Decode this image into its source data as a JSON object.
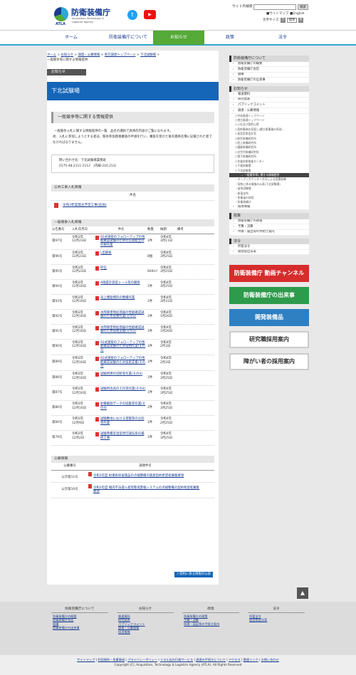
{
  "header": {
    "site_search_label": "サイト内検索",
    "search_button": "検索",
    "sitemap": "サイトマップ",
    "english": "English",
    "text_size_label": "文字サイズ",
    "size_small": "小",
    "size_normal": "標準",
    "size_large": "大",
    "logo_main": "防衛装備庁",
    "logo_sub1": "Acquisition,Technology &",
    "logo_sub2": "Logistics Agency",
    "logo_atla": "ATLA"
  },
  "nav": [
    {
      "label": "ホーム"
    },
    {
      "label": "防衛装備庁について"
    },
    {
      "label": "お知らせ"
    },
    {
      "label": "政策"
    },
    {
      "label": "法令"
    }
  ],
  "breadcrumb": [
    "ホーム",
    "お知らせ",
    "調達・公募情報",
    "地方調達トップページ",
    "下北試験場",
    "一般競争等に関する情報提供"
  ],
  "page": {
    "category": "お知らせ",
    "title": "下北試験場",
    "subtitle": "一般競争等に関する情報提供",
    "intro": "一般競争入札に関する情報提供の一覧　品名の選択で具体的内容がご覧になれます。",
    "note": "尚、入札に参加しようとする者は、競争参加資格審査の申請を行い、審査を受けた後有資格名簿に記載された者でなければなりません。",
    "contact1": "問い合わせ先：下北試験場業務班",
    "contact2": "0175-48-2111-2112　(内線-210,213)"
  },
  "public_works": {
    "heading": "公共工事入札情報",
    "col_name": "件名",
    "items": [
      "令和3年度発注予定工事(追加)"
    ]
  },
  "competitive": {
    "heading": "一般競争入札情報",
    "headers": [
      "公告番号",
      "入札年月日",
      "件名",
      "数量",
      "納期",
      "備考"
    ],
    "rows": [
      {
        "no": "第97号",
        "date": "令和3年\n12月23日",
        "name": "92式遠管のフォローアップの性能確認試験のための信管組立の作製作業",
        "qty": "1件",
        "due": "令和4年\n3月11日"
      },
      {
        "no": "第96号",
        "date": "令和3年\n12月23日",
        "name": "L型鋼板",
        "qty": "8個",
        "due": "令和4年\n3月25日"
      },
      {
        "no": "第95号",
        "date": "令和3年\n12月23日",
        "name": "砕石",
        "qty": "600m³",
        "due": "令和4年\n3月25日"
      },
      {
        "no": "第94号",
        "date": "令和3年\n12月16日",
        "name": "A砲座計測室レール等の補修",
        "qty": "1件",
        "due": "令和4年\n3月25日"
      },
      {
        "no": "第93号",
        "date": "令和3年\n12月16日",
        "name": "海上爆発標的の整備作業",
        "qty": "1件",
        "due": "令和4年\n3月31日"
      },
      {
        "no": "第92号",
        "date": "令和3年\n12月16日",
        "name": "水際障害物処理器の性能確認試験のため役務作業(その2)",
        "qty": "1件",
        "due": "令和4年\n1月26日"
      },
      {
        "no": "第91号",
        "date": "令和3年\n12月16日",
        "name": "水際障害物処理器の性能確認試験のため技術支援(その2)",
        "qty": "1件",
        "due": "令和4年\n1月26日"
      },
      {
        "no": "第90号",
        "date": "令和3年\n12月16日",
        "name": "92式遠管のフォローアップの性能確認試験のため役務作業(その3)",
        "qty": "1件",
        "due": "令和4年\n2月3日"
      },
      {
        "no": "第89号",
        "date": "令和3年\n12月16日",
        "name": "92式遠管のフォローアップの性能確認試験のため技術支援(その3)",
        "qty": "1件",
        "due": "令和4年\n2月3日"
      },
      {
        "no": "第88号",
        "date": "令和3年\n12月16日",
        "name": "試験用弾の切断等作業(その4)",
        "qty": "1件",
        "due": "令和4年\n3月25日"
      },
      {
        "no": "第87号",
        "date": "令和3年\n12月16日",
        "name": "試験用治具の工作等作業(その4)",
        "qty": "1件",
        "due": "令和4年\n3月25日"
      },
      {
        "no": "第86号",
        "date": "令和3年\n12月16日",
        "name": "射撃観測データの収集等作業(その4)",
        "qty": "1件",
        "due": "令和4年\n3月25日"
      },
      {
        "no": "第84号",
        "date": "令和3年\n12月9日",
        "name": "試験敷地における害獣等の分別等作業",
        "qty": "1件",
        "due": "令和4年\n2月25日"
      },
      {
        "no": "第79号",
        "date": "令和3年\n12月2日",
        "name": "試験準備室温室用空調気系の補修工事",
        "qty": "1件",
        "due": "令和4年\n3月25日"
      }
    ]
  },
  "kobo": {
    "heading": "公募情報",
    "col_no": "公募番号",
    "col_name": "調達件名",
    "rows": [
      {
        "no": "公示第11号",
        "name": "令和3年度 射場各係留施設の点検整備の随意契約希望者募集要領"
      },
      {
        "no": "公示第10号",
        "name": "令和3年度 場内不法侵入者等警戒警報システムの点検整備の契約希望者募集要領"
      }
    ]
  },
  "contract_link": "＞契約に係る情報の公表",
  "sidebar": {
    "about_heading": "防衛装備庁について",
    "about_items": [
      "防衛装備庁の概要",
      "防衛装備庁長官",
      "組織",
      "防衛装備庁の出来事"
    ],
    "news_heading": "お知らせ",
    "news_items": [
      "報道資料",
      "研究発表",
      "パブリックコメント",
      "調達・公募情報"
    ],
    "sub_items": [
      "中央調達トップページ",
      "地方調達トップページ",
      "入札及び契約心得",
      "契約事務の見直し(最大限事業の再発...",
      "長官官房会計官",
      "航空装備研究所",
      "陸上装備研究所",
      "艦艇装備研究所",
      "次世代装備研究所",
      "電子装備研究所",
      "先進技術推進センター",
      "千歳試験場",
      "下北試験場"
    ],
    "current_item": "一般競争等に関する情報提供",
    "sub_items2": [
      "オープンカウンター方式による見積依頼",
      "契約に係る情報の公表(下北試験場)",
      "岐阜試験場",
      "新島支所",
      "防衛省の採用",
      "防衛装備庁"
    ],
    "news_items2": [
      "採用情報"
    ],
    "policy_heading": "政策",
    "policy_items": [
      "防衛装備庁の政策",
      "予算・決算",
      "申請・届出等の手続き案内"
    ],
    "law_heading": "法令",
    "law_items": [
      "所管法令",
      "国会提出法案"
    ]
  },
  "banners": [
    {
      "label": "防衛装備庁 動画チャンネル",
      "color": "#d62c2c"
    },
    {
      "label": "防衛装備庁の出来事",
      "color": "#2e9a4b"
    },
    {
      "label": "開発装備品",
      "color": "#2e80c3"
    },
    {
      "label": "研究職採用案内",
      "color": "#333333"
    },
    {
      "label": "障がい者の採用案内",
      "color": "#333333"
    }
  ],
  "footer": {
    "cols": [
      {
        "title": "防衛装備庁について",
        "links": [
          "防衛装備庁の概要",
          "防衛装備庁長官",
          "組織",
          "防衛装備庁の出来事"
        ]
      },
      {
        "title": "お知らせ",
        "links": [
          "報道資料",
          "研究発表",
          "パブリックコメント",
          "調達・公募情報",
          "採用情報"
        ]
      },
      {
        "title": "政策",
        "links": [
          "防衛装備庁の政策",
          "予算・決算",
          "申請・届出等の手続き案内"
        ]
      },
      {
        "title": "法令",
        "links": [
          "所管法令",
          "国会提出法案"
        ]
      }
    ],
    "links": [
      "サイトマップ",
      "利用規約・免責事項",
      "プライバシーポリシー",
      "ミエル化の行政サービス",
      "調達の手続きについて",
      "アクセス",
      "関連リンク",
      "お問い合わせ"
    ],
    "copyright": "Copyright (C), Acquisition, Technology & Logistics Agency (ATLA). All Rights Reserved"
  }
}
